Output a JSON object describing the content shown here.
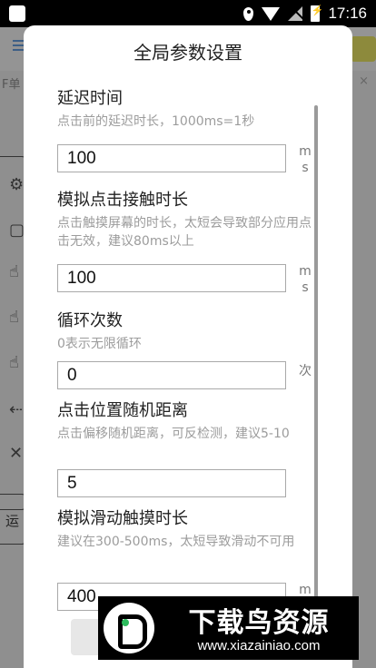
{
  "status_bar": {
    "time": "17:16",
    "icons": [
      "app-icon",
      "location-icon",
      "wifi-icon",
      "signal-icon",
      "battery-charging-icon"
    ]
  },
  "background": {
    "partial_text": "F单",
    "close_glyph": "×",
    "side_button": "运"
  },
  "dialog": {
    "title": "全局参数设置",
    "items": [
      {
        "label": "延迟时间",
        "desc": "点击前的延迟时长，1000ms=1秒",
        "value": "100",
        "unit_top": "m",
        "unit_bottom": "s"
      },
      {
        "label": "模拟点击接触时长",
        "desc": "点击触摸屏幕的时长，太短会导致部分应用点击无效，建议80ms以上",
        "value": "100",
        "unit_top": "m",
        "unit_bottom": "s"
      },
      {
        "label": "循环次数",
        "desc": "0表示无限循环",
        "value": "0",
        "unit_top": "次",
        "unit_bottom": ""
      },
      {
        "label": "点击位置随机距离",
        "desc": "点击偏移随机距离，可反检测，建议5-10",
        "value": "5",
        "unit_top": "",
        "unit_bottom": ""
      },
      {
        "label": "模拟滑动触摸时长",
        "desc": "建议在300-500ms，太短导致滑动不可用",
        "value": "400",
        "unit_top": "m",
        "unit_bottom": ""
      }
    ]
  },
  "watermark": {
    "title": "下载鸟资源",
    "url": "www.xiazainiao.com"
  },
  "colors": {
    "overlay": "#8f8f8f",
    "dialog_bg": "#ffffff",
    "field_border": "#a9a9a9",
    "desc_text": "#9c9c9c"
  }
}
